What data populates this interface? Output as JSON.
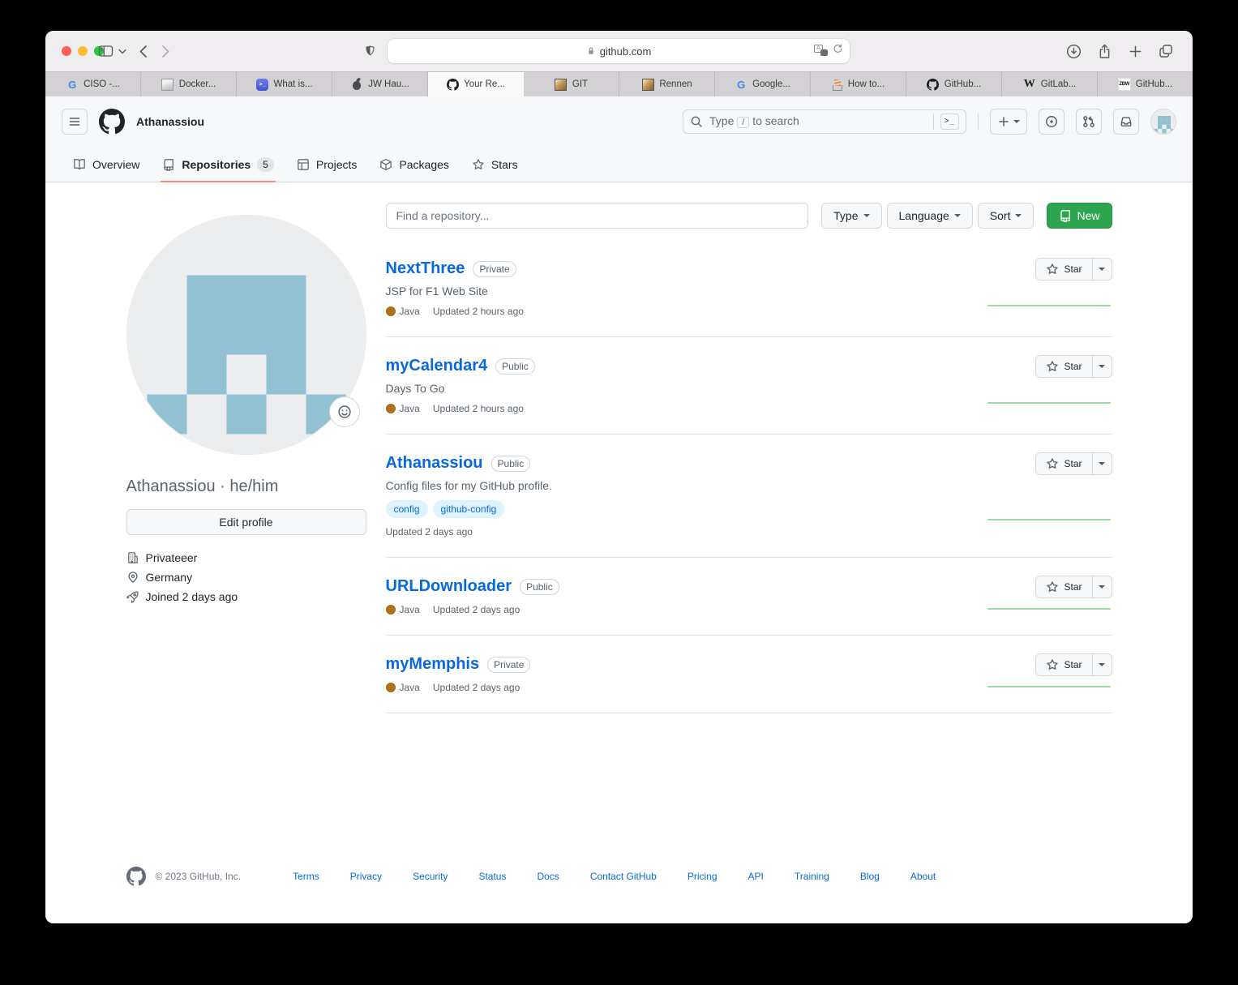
{
  "browser": {
    "address": "github.com",
    "tabs": [
      {
        "label": "CISO -...",
        "favicon": "google"
      },
      {
        "label": "Docker...",
        "favicon": "page-thumbnail"
      },
      {
        "label": "What is...",
        "favicon": "terminal"
      },
      {
        "label": "JW Hau...",
        "favicon": "apple"
      },
      {
        "label": "Your Re...",
        "favicon": "github",
        "active": true
      },
      {
        "label": "GIT",
        "favicon": "picture"
      },
      {
        "label": "Rennen",
        "favicon": "picture"
      },
      {
        "label": "Google...",
        "favicon": "google"
      },
      {
        "label": "How to...",
        "favicon": "stackoverflow"
      },
      {
        "label": "GitHub...",
        "favicon": "github"
      },
      {
        "label": "GitLab...",
        "favicon": "wikipedia"
      },
      {
        "label": "GitHub...",
        "favicon": "zbw"
      }
    ]
  },
  "header": {
    "owner": "Athanassiou",
    "search_placeholder": "Type / to search",
    "slash_key": "/",
    "command_key": ">_",
    "nav": [
      {
        "label": "Overview"
      },
      {
        "label": "Repositories",
        "count": "5",
        "active": true
      },
      {
        "label": "Projects"
      },
      {
        "label": "Packages"
      },
      {
        "label": "Stars"
      }
    ]
  },
  "profile": {
    "username": "Athanassiou · he/him",
    "edit_button": "Edit profile",
    "company": "Privateeer",
    "location": "Germany",
    "joined": "Joined 2 days ago"
  },
  "filters": {
    "search_placeholder": "Find a repository...",
    "type_label": "Type",
    "language_label": "Language",
    "sort_label": "Sort",
    "new_label": "New"
  },
  "star_label": "Star",
  "repos": [
    {
      "name": "NextThree",
      "visibility": "Private",
      "description": "JSP for F1 Web Site",
      "language": "Java",
      "language_color": "#b07219",
      "updated": "Updated 2 hours ago"
    },
    {
      "name": "myCalendar4",
      "visibility": "Public",
      "description": "Days To Go",
      "language": "Java",
      "language_color": "#b07219",
      "updated": "Updated 2 hours ago"
    },
    {
      "name": "Athanassiou",
      "visibility": "Public",
      "description": "Config files for my GitHub profile.",
      "topics": [
        "config",
        "github-config"
      ],
      "updated": "Updated 2 days ago"
    },
    {
      "name": "URLDownloader",
      "visibility": "Public",
      "language": "Java",
      "language_color": "#b07219",
      "updated": "Updated 2 days ago"
    },
    {
      "name": "myMemphis",
      "visibility": "Private",
      "language": "Java",
      "language_color": "#b07219",
      "updated": "Updated 2 days ago"
    }
  ],
  "footer": {
    "copyright": "© 2023 GitHub, Inc.",
    "links": [
      "Terms",
      "Privacy",
      "Security",
      "Status",
      "Docs",
      "Contact GitHub",
      "Pricing",
      "API",
      "Training",
      "Blog",
      "About"
    ]
  },
  "colors": {
    "new_button_green": "#2da44e",
    "link_blue": "#0969da",
    "java_dot": "#b07219",
    "active_tab_underline": "#fd8c73",
    "identicon_blue": "#92c1d3",
    "sparkline_green": "#9fd8a4"
  }
}
